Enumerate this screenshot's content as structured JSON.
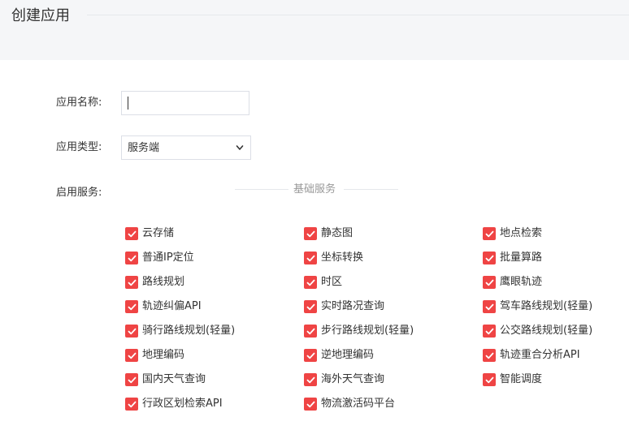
{
  "header": {
    "title": "创建应用"
  },
  "form": {
    "name_label": "应用名称:",
    "name_value": "",
    "type_label": "应用类型:",
    "type_selected": "服务端",
    "services_label": "启用服务:"
  },
  "services": {
    "section_title": "基础服务",
    "items": [
      {
        "label": "云存储",
        "checked": true
      },
      {
        "label": "静态图",
        "checked": true
      },
      {
        "label": "地点检索",
        "checked": true
      },
      {
        "label": "普通IP定位",
        "checked": true
      },
      {
        "label": "坐标转换",
        "checked": true
      },
      {
        "label": "批量算路",
        "checked": true
      },
      {
        "label": "路线规划",
        "checked": true
      },
      {
        "label": "时区",
        "checked": true
      },
      {
        "label": "鹰眼轨迹",
        "checked": true
      },
      {
        "label": "轨迹纠偏API",
        "checked": true
      },
      {
        "label": "实时路况查询",
        "checked": true
      },
      {
        "label": "驾车路线规划(轻量)",
        "checked": true
      },
      {
        "label": "骑行路线规划(轻量)",
        "checked": true
      },
      {
        "label": "步行路线规划(轻量)",
        "checked": true
      },
      {
        "label": "公交路线规划(轻量)",
        "checked": true
      },
      {
        "label": "地理编码",
        "checked": true
      },
      {
        "label": "逆地理编码",
        "checked": true
      },
      {
        "label": "轨迹重合分析API",
        "checked": true
      },
      {
        "label": "国内天气查询",
        "checked": true
      },
      {
        "label": "海外天气查询",
        "checked": true
      },
      {
        "label": "智能调度",
        "checked": true
      },
      {
        "label": "行政区划检索API",
        "checked": true
      },
      {
        "label": "物流激活码平台",
        "checked": true
      }
    ]
  },
  "colors": {
    "accent": "#ef4444",
    "header_bg": "#f5f6f8",
    "border": "#dcdfe6"
  }
}
